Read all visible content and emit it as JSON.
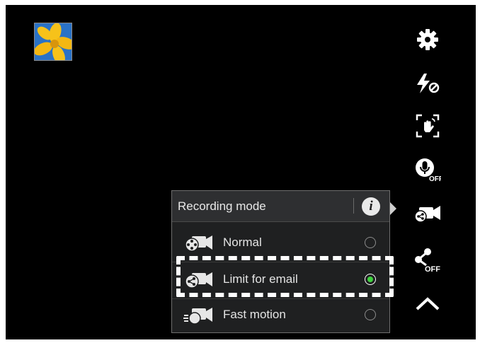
{
  "recording_mode_panel": {
    "title": "Recording mode",
    "options": [
      {
        "label": "Normal",
        "selected": false
      },
      {
        "label": "Limit for email",
        "selected": true
      },
      {
        "label": "Fast motion",
        "selected": false
      }
    ]
  },
  "side_toolbar": {
    "items": [
      "settings-gear-icon",
      "flash-off-icon",
      "gesture-shot-icon",
      "voice-control-off-icon",
      "recording-mode-icon",
      "share-shot-off-icon",
      "collapse-chevron-up-icon"
    ]
  },
  "colors": {
    "selected_radio": "#3ed23e",
    "panel_bg": "#1f2021",
    "highlight_border": "#ffffff"
  }
}
